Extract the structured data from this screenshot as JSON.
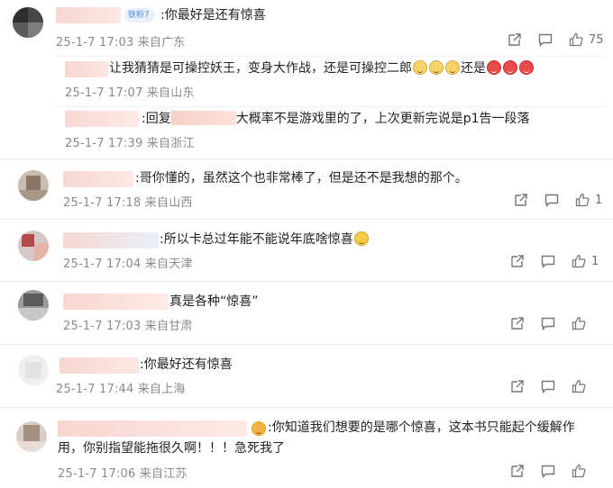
{
  "comments": [
    {
      "text": ":你最好是还有惊喜",
      "meta": "25-1-7 17:03 来自广东",
      "likes": "75",
      "badge": "铁粉7",
      "replies": [
        {
          "text_a": "让我猜猜是可操控妖王，变身大作战，还是可操控二郎",
          "text_b": "还是",
          "meta": "25-1-7 17:07 来自山东"
        },
        {
          "prefix": ":回复",
          "text": "大概率不是游戏里的了，上次更新完说是p1告一段落",
          "meta": "25-1-7 17:39 来自浙江"
        }
      ]
    },
    {
      "text": ":哥你懂的，虽然这个也非常棒了，但是还不是我想的那个。",
      "meta": "25-1-7 17:18 来自山西",
      "likes": "1"
    },
    {
      "text": ":所以卡总过年能不能说年底啥惊喜",
      "meta": "25-1-7 17:04 来自天津",
      "likes": "1"
    },
    {
      "text": "真是各种“惊喜”",
      "meta": "25-1-7 17:03 来自甘肃",
      "likes": ""
    },
    {
      "text": ":你最好还有惊喜",
      "meta": "25-1-7 17:44 来自上海",
      "likes": ""
    },
    {
      "text_line1": ":你知道我们想要的是哪个惊喜，这本书只能起个缓解作",
      "text_line2": "用，你别指望能拖很久啊！！！急死我了",
      "meta": "25-1-7 17:06 来自江苏",
      "likes": ""
    }
  ],
  "icons": {
    "share": "share-icon",
    "comment": "comment-icon",
    "like": "like-icon"
  },
  "colors": {
    "meta": "#8a8a8a",
    "badge_bg": "#e8f1fc",
    "badge_text": "#4d8bd6",
    "divider": "#ececec"
  }
}
